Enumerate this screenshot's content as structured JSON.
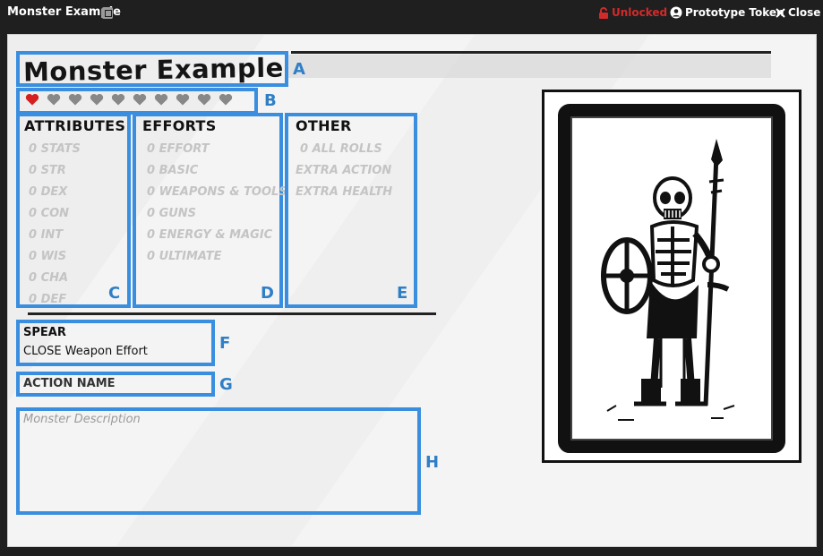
{
  "window": {
    "title": "Monster Example",
    "unlocked_label": "Unlocked",
    "prototype_token_label": "Prototype Token",
    "close_label": "Close",
    "accent_color": "#3a8ee0",
    "unlocked_color": "#d22a2a"
  },
  "sheet": {
    "name": "Monster Example",
    "hearts": {
      "filled": 1,
      "total": 10,
      "filled_color": "#d42020",
      "empty_color": "#888888"
    },
    "attributes": {
      "heading": "ATTRIBUTES",
      "items": [
        "0 STATS",
        "0 STR",
        "0 DEX",
        "0 CON",
        "0 INT",
        "0 WIS",
        "0 CHA",
        "0 DEF"
      ]
    },
    "efforts": {
      "heading": "EFFORTS",
      "items": [
        "0 EFFORT",
        "0 BASIC",
        "0 WEAPONS & TOOLS",
        "0 GUNS",
        "0 ENERGY & MAGIC",
        "0 ULTIMATE"
      ]
    },
    "other": {
      "heading": "OTHER",
      "items": [
        "0 ALL ROLLS",
        "EXTRA ACTION",
        "EXTRA HEALTH"
      ]
    },
    "weapon": {
      "name": "SPEAR",
      "description": "CLOSE Weapon Effort"
    },
    "action": {
      "name": "ACTION NAME"
    },
    "description_placeholder": "Monster Description",
    "markers": [
      "A",
      "B",
      "C",
      "D",
      "E",
      "F",
      "G",
      "H"
    ]
  }
}
